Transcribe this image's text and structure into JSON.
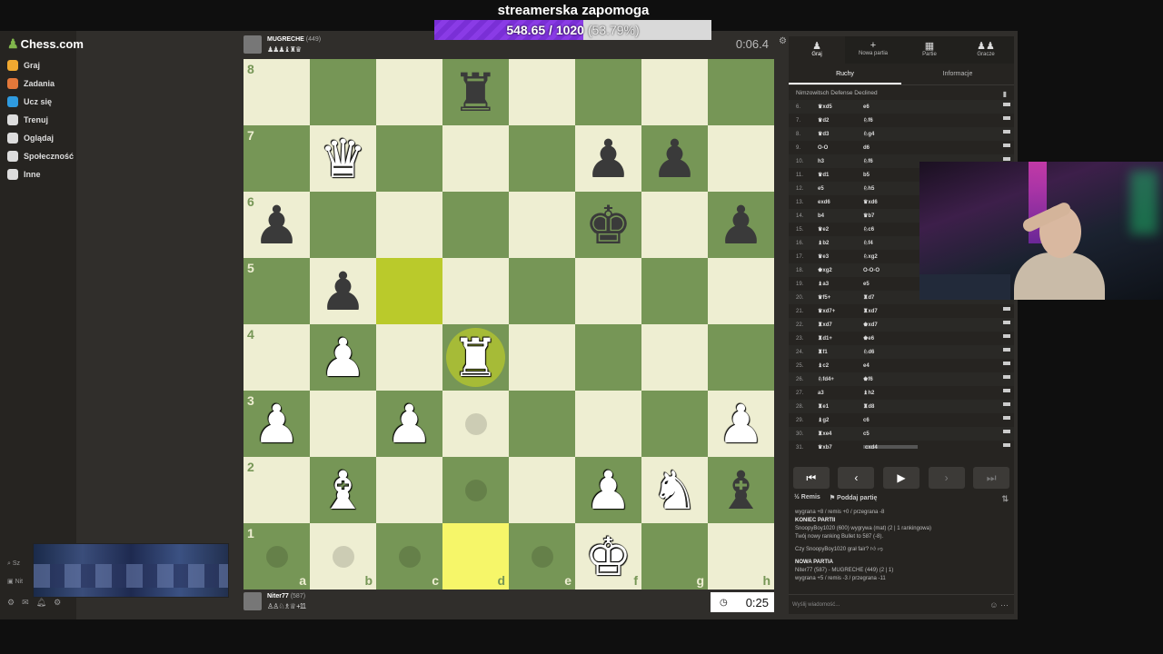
{
  "banner": {
    "title": "streamerska zapomoga",
    "progress_text": "548.65 / 1020",
    "progress_pct_text": "(53.79%)",
    "progress_fraction": 0.538
  },
  "sidebar": {
    "logo": "Chess.com",
    "items": [
      {
        "label": "Graj",
        "color": "#f0a830"
      },
      {
        "label": "Zadania",
        "color": "#e3783a"
      },
      {
        "label": "Ucz się",
        "color": "#2f9be0"
      },
      {
        "label": "Trenuj",
        "color": "#dddddd"
      },
      {
        "label": "Oglądaj",
        "color": "#dddddd"
      },
      {
        "label": "Społeczność",
        "color": "#dddddd"
      },
      {
        "label": "Inne",
        "color": "#dddddd"
      }
    ],
    "search_label": "Sz",
    "user_label": "Nit"
  },
  "player_top": {
    "name": "MUGRECHE",
    "rating": "(449)",
    "clock": "0:06.4",
    "captured": "♟♟♟♝♜♛"
  },
  "player_bottom": {
    "name": "Niter77",
    "rating": "(587)",
    "clock": "0:25",
    "captured": "♙♙♘♗♕ +11"
  },
  "board": {
    "squares": [
      [
        "",
        "",
        "",
        "bR",
        "",
        "",
        "",
        ""
      ],
      [
        "",
        "wQ",
        "",
        "",
        "",
        "bP",
        "bP",
        ""
      ],
      [
        "bP",
        "",
        "",
        "",
        "",
        "bK",
        "",
        "bP"
      ],
      [
        "",
        "bP",
        "",
        "",
        "",
        "",
        "",
        ""
      ],
      [
        "",
        "wP",
        "",
        "wR",
        "",
        "",
        "",
        ""
      ],
      [
        "wP",
        "",
        "wP",
        "",
        "",
        "",
        "",
        "wP"
      ],
      [
        "",
        "wB",
        "",
        "",
        "",
        "wP",
        "wN",
        "bB"
      ],
      [
        "",
        "",
        "",
        "",
        "",
        "wK",
        "",
        ""
      ]
    ],
    "ranks": [
      "8",
      "7",
      "6",
      "5",
      "4",
      "3",
      "2",
      "1"
    ],
    "files": [
      "a",
      "b",
      "c",
      "d",
      "e",
      "f",
      "g",
      "h"
    ],
    "highlight_dark": [
      [
        3,
        2
      ]
    ],
    "highlight_light": [
      [
        7,
        3
      ]
    ],
    "selected": [
      4,
      3
    ],
    "hints": [
      [
        5,
        3
      ],
      [
        6,
        3
      ],
      [
        7,
        0
      ],
      [
        7,
        1
      ],
      [
        7,
        2
      ],
      [
        7,
        4
      ]
    ]
  },
  "panel": {
    "tabs": [
      {
        "icon": "♟",
        "label": "Graj"
      },
      {
        "icon": "+",
        "label": "Nowa partia"
      },
      {
        "icon": "▦",
        "label": "Partie"
      },
      {
        "icon": "♟♟",
        "label": "Gracze"
      }
    ],
    "subtabs": [
      "Ruchy",
      "Informacje"
    ],
    "opening": "Nimzowitsch Defense Declined",
    "moves": [
      {
        "n": "6.",
        "w": "♛xd5",
        "b": "e6"
      },
      {
        "n": "7.",
        "w": "♛d2",
        "b": "♘f6"
      },
      {
        "n": "8.",
        "w": "♛d3",
        "b": "♘g4"
      },
      {
        "n": "9.",
        "w": "O-O",
        "b": "d6"
      },
      {
        "n": "10.",
        "w": "h3",
        "b": "♘f6"
      },
      {
        "n": "11.",
        "w": "♛d1",
        "b": "b5"
      },
      {
        "n": "12.",
        "w": "e5",
        "b": "♘h5"
      },
      {
        "n": "13.",
        "w": "exd6",
        "b": "♛xd6"
      },
      {
        "n": "14.",
        "w": "b4",
        "b": "♛b7"
      },
      {
        "n": "15.",
        "w": "♛e2",
        "b": "♘c6"
      },
      {
        "n": "16.",
        "w": "♝b2",
        "b": "♘f4"
      },
      {
        "n": "17.",
        "w": "♛e3",
        "b": "♘xg2"
      },
      {
        "n": "18.",
        "w": "♚xg2",
        "b": "O-O-O"
      },
      {
        "n": "19.",
        "w": "♝a3",
        "b": "e5"
      },
      {
        "n": "20.",
        "w": "♛f5+",
        "b": "♜d7"
      },
      {
        "n": "21.",
        "w": "♛xd7+",
        "b": "♜xd7"
      },
      {
        "n": "22.",
        "w": "♜xd7",
        "b": "♚xd7"
      },
      {
        "n": "23.",
        "w": "♜d1+",
        "b": "♚e6"
      },
      {
        "n": "24.",
        "w": "♜f1",
        "b": "♘d6"
      },
      {
        "n": "25.",
        "w": "♝c2",
        "b": "e4"
      },
      {
        "n": "26.",
        "w": "♘fd4+",
        "b": "♚f6"
      },
      {
        "n": "27.",
        "w": "a3",
        "b": "♝h2"
      },
      {
        "n": "28.",
        "w": "♜e1",
        "b": "♜d8"
      },
      {
        "n": "29.",
        "w": "♝g2",
        "b": "c6"
      },
      {
        "n": "30.",
        "w": "♜xe4",
        "b": "c5"
      },
      {
        "n": "31.",
        "w": "♛xb7",
        "b": "cxd4"
      }
    ],
    "actions": {
      "draw": "Remis",
      "resign": "Poddaj partię"
    },
    "chat": {
      "line1": "wygrana +8 / remis +0 / przegrana -8",
      "end_title": "KONIEC PARTII",
      "end_line1": "SnoopyBoy1020 (600) wygrywa (mat) (2 | 1 rankingowa)",
      "end_line2": "Twój nowy ranking Bullet to 587 (-8).",
      "fair": "Czy SnoopyBoy1020 grał fair?",
      "new_title": "NOWA PARTIA",
      "new_line1": "Niter77 (587) - MUGRECHE (449) (2 | 1)",
      "new_line2": "wygrana +5 / remis -3 / przegrana -11",
      "input_placeholder": "Wyślij wiadomość..."
    }
  }
}
